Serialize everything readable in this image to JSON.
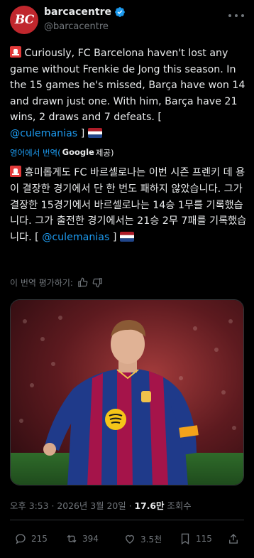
{
  "author": {
    "avatar_text": "BC",
    "display_name": "barcacentre",
    "handle": "@barcacentre"
  },
  "tweet": {
    "text_en": "Curiously, FC Barcelona haven't lost any game without Frenkie de Jong this season. In the 15 games he's missed, Barça have won 14 and drawn just one. With him, Barça have 21 wins, 2 draws and 7 defeats. [",
    "mention_en": "@culemanias",
    "close_en": "]",
    "translate_label": "영어에서 번역(",
    "translate_provider_g": "Google",
    "translate_provider_suffix": "제공)",
    "text_ko": "흥미롭게도 FC 바르셀로나는 이번 시즌 프렌키 데 용이 결장한 경기에서 단 한 번도 패하지 않았습니다. 그가 결장한 15경기에서 바르셀로나는 14승 1무를 기록했습니다. 그가 출전한 경기에서는 21승 2무 7패를 기록했습니다. [",
    "mention_ko": "@culemanias",
    "close_ko": "]",
    "rate_label": "이 번역 평가하기:"
  },
  "meta": {
    "time": "오후 3:53",
    "separator": " · ",
    "date": "2026년 3월 20일",
    "views_count": "17.6만",
    "views_label": "조회수"
  },
  "actions": {
    "replies": "215",
    "reposts": "394",
    "likes": "3.5천",
    "bookmarks": "115"
  },
  "colors": {
    "background": "#000000",
    "text": "#e7e9ea",
    "secondary": "#71767b",
    "link": "#1d9bf0",
    "avatar": "#c0272d"
  }
}
